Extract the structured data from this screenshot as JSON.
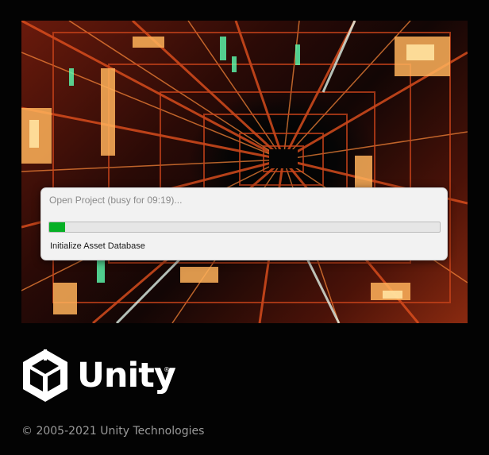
{
  "splash": {
    "dialog": {
      "title": "Open Project (busy for 09:19)...",
      "progress": 0.04,
      "status": "Initialize Asset Database"
    },
    "brand": {
      "wordmark": "Unity",
      "registered_mark": "®",
      "logo_icon": "unity-cube-icon"
    },
    "copyright": "© 2005-2021 Unity Technologies"
  },
  "colors": {
    "background": "#030303",
    "progress_fill": "#06b025",
    "dialog_bg": "#f2f2f2",
    "accent_warm": "#ff6a2a",
    "accent_green": "#5dffb0"
  }
}
